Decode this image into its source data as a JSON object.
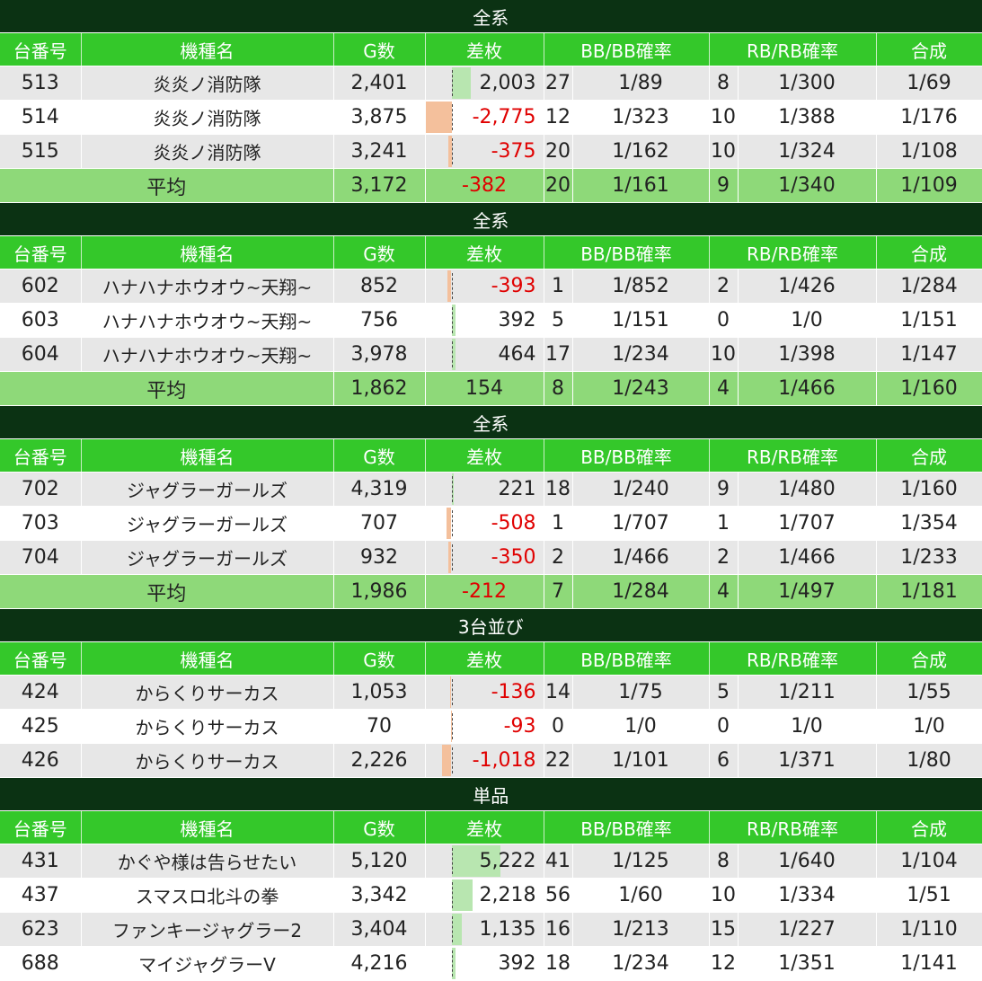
{
  "columns": [
    "台番号",
    "機種名",
    "G数",
    "差枚",
    "BB/BB確率",
    "RB/RB確率",
    "合成"
  ],
  "groups": [
    {
      "title": "全系",
      "rows": [
        {
          "no": "513",
          "model": "炎炎ノ消防隊",
          "games": "2,401",
          "diff": "2,003",
          "diff_value": 2003,
          "bb": "27",
          "bb_rate": "1/89",
          "rb": "8",
          "rb_rate": "1/300",
          "combined": "1/69"
        },
        {
          "no": "514",
          "model": "炎炎ノ消防隊",
          "games": "3,875",
          "diff": "-2,775",
          "diff_value": -2775,
          "bb": "12",
          "bb_rate": "1/323",
          "rb": "10",
          "rb_rate": "1/388",
          "combined": "1/176"
        },
        {
          "no": "515",
          "model": "炎炎ノ消防隊",
          "games": "3,241",
          "diff": "-375",
          "diff_value": -375,
          "bb": "20",
          "bb_rate": "1/162",
          "rb": "10",
          "rb_rate": "1/324",
          "combined": "1/108"
        }
      ],
      "avg": {
        "label": "平均",
        "games": "3,172",
        "diff": "-382",
        "diff_value": -382,
        "bb": "20",
        "bb_rate": "1/161",
        "rb": "9",
        "rb_rate": "1/340",
        "combined": "1/109"
      }
    },
    {
      "title": "全系",
      "rows": [
        {
          "no": "602",
          "model": "ハナハナホウオウ~天翔~",
          "games": "852",
          "diff": "-393",
          "diff_value": -393,
          "bb": "1",
          "bb_rate": "1/852",
          "rb": "2",
          "rb_rate": "1/426",
          "combined": "1/284"
        },
        {
          "no": "603",
          "model": "ハナハナホウオウ~天翔~",
          "games": "756",
          "diff": "392",
          "diff_value": 392,
          "bb": "5",
          "bb_rate": "1/151",
          "rb": "0",
          "rb_rate": "1/0",
          "combined": "1/151"
        },
        {
          "no": "604",
          "model": "ハナハナホウオウ~天翔~",
          "games": "3,978",
          "diff": "464",
          "diff_value": 464,
          "bb": "17",
          "bb_rate": "1/234",
          "rb": "10",
          "rb_rate": "1/398",
          "combined": "1/147"
        }
      ],
      "avg": {
        "label": "平均",
        "games": "1,862",
        "diff": "154",
        "diff_value": 154,
        "bb": "8",
        "bb_rate": "1/243",
        "rb": "4",
        "rb_rate": "1/466",
        "combined": "1/160"
      }
    },
    {
      "title": "全系",
      "rows": [
        {
          "no": "702",
          "model": "ジャグラーガールズ",
          "games": "4,319",
          "diff": "221",
          "diff_value": 221,
          "bb": "18",
          "bb_rate": "1/240",
          "rb": "9",
          "rb_rate": "1/480",
          "combined": "1/160"
        },
        {
          "no": "703",
          "model": "ジャグラーガールズ",
          "games": "707",
          "diff": "-508",
          "diff_value": -508,
          "bb": "1",
          "bb_rate": "1/707",
          "rb": "1",
          "rb_rate": "1/707",
          "combined": "1/354"
        },
        {
          "no": "704",
          "model": "ジャグラーガールズ",
          "games": "932",
          "diff": "-350",
          "diff_value": -350,
          "bb": "2",
          "bb_rate": "1/466",
          "rb": "2",
          "rb_rate": "1/466",
          "combined": "1/233"
        }
      ],
      "avg": {
        "label": "平均",
        "games": "1,986",
        "diff": "-212",
        "diff_value": -212,
        "bb": "7",
        "bb_rate": "1/284",
        "rb": "4",
        "rb_rate": "1/497",
        "combined": "1/181"
      }
    },
    {
      "title": "3台並び",
      "rows": [
        {
          "no": "424",
          "model": "からくりサーカス",
          "games": "1,053",
          "diff": "-136",
          "diff_value": -136,
          "bb": "14",
          "bb_rate": "1/75",
          "rb": "5",
          "rb_rate": "1/211",
          "combined": "1/55"
        },
        {
          "no": "425",
          "model": "からくりサーカス",
          "games": "70",
          "diff": "-93",
          "diff_value": -93,
          "bb": "0",
          "bb_rate": "1/0",
          "rb": "0",
          "rb_rate": "1/0",
          "combined": "1/0"
        },
        {
          "no": "426",
          "model": "からくりサーカス",
          "games": "2,226",
          "diff": "-1,018",
          "diff_value": -1018,
          "bb": "22",
          "bb_rate": "1/101",
          "rb": "6",
          "rb_rate": "1/371",
          "combined": "1/80"
        }
      ]
    },
    {
      "title": "単品",
      "rows": [
        {
          "no": "431",
          "model": "かぐや様は告らせたい",
          "games": "5,120",
          "diff": "5,222",
          "diff_value": 5222,
          "bb": "41",
          "bb_rate": "1/125",
          "rb": "8",
          "rb_rate": "1/640",
          "combined": "1/104"
        },
        {
          "no": "437",
          "model": "スマスロ北斗の拳",
          "games": "3,342",
          "diff": "2,218",
          "diff_value": 2218,
          "bb": "56",
          "bb_rate": "1/60",
          "rb": "10",
          "rb_rate": "1/334",
          "combined": "1/51"
        },
        {
          "no": "623",
          "model": "ファンキージャグラー2",
          "games": "3,404",
          "diff": "1,135",
          "diff_value": 1135,
          "bb": "16",
          "bb_rate": "1/213",
          "rb": "15",
          "rb_rate": "1/227",
          "combined": "1/110"
        },
        {
          "no": "688",
          "model": "マイジャグラーV",
          "games": "4,216",
          "diff": "392",
          "diff_value": 392,
          "bb": "18",
          "bb_rate": "1/234",
          "rb": "12",
          "rb_rate": "1/351",
          "combined": "1/141"
        }
      ]
    }
  ],
  "colors": {
    "title_bg": "#0b3213",
    "header_bg": "#34c82a",
    "avg_bg": "#8ed979",
    "row_alt": "#e7e7e7",
    "positive_bar": "#b8e6b0",
    "negative_bar": "#f4c09c",
    "negative_text": "#e00000"
  }
}
